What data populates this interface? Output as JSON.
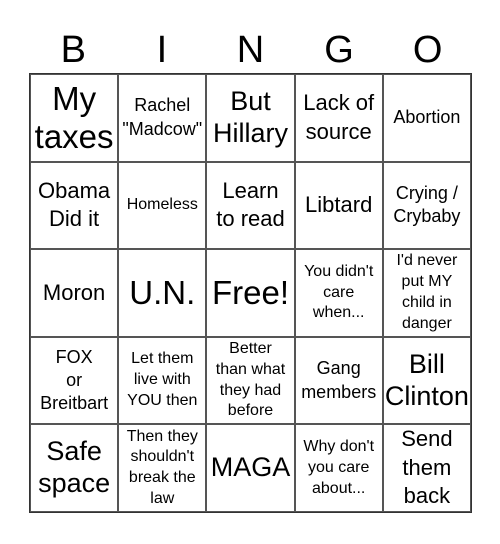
{
  "header": [
    "B",
    "I",
    "N",
    "G",
    "O"
  ],
  "cells": [
    {
      "text": "My\ntaxes",
      "size": "s-xl"
    },
    {
      "text": "Rachel\n\"Madcow\"",
      "size": "s-s"
    },
    {
      "text": "But\nHillary",
      "size": "s-l"
    },
    {
      "text": "Lack of\nsource",
      "size": "s-m"
    },
    {
      "text": "Abortion",
      "size": "s-s"
    },
    {
      "text": "Obama\nDid it",
      "size": "s-m"
    },
    {
      "text": "Homeless",
      "size": "s-xs"
    },
    {
      "text": "Learn\nto read",
      "size": "s-m"
    },
    {
      "text": "Libtard",
      "size": "s-m"
    },
    {
      "text": "Crying /\nCrybaby",
      "size": "s-s"
    },
    {
      "text": "Moron",
      "size": "s-m"
    },
    {
      "text": "U.N.",
      "size": "s-xl"
    },
    {
      "text": "Free!",
      "size": "s-xl"
    },
    {
      "text": "You didn't\ncare\nwhen...",
      "size": "s-xs"
    },
    {
      "text": "I'd never\nput MY\nchild in\ndanger",
      "size": "s-xs"
    },
    {
      "text": "FOX\nor\nBreitbart",
      "size": "s-s"
    },
    {
      "text": "Let them\nlive with\nYOU then",
      "size": "s-xs"
    },
    {
      "text": "Better\nthan what\nthey had\nbefore",
      "size": "s-xs"
    },
    {
      "text": "Gang\nmembers",
      "size": "s-s"
    },
    {
      "text": "Bill\nClinton",
      "size": "s-l"
    },
    {
      "text": "Safe\nspace",
      "size": "s-l"
    },
    {
      "text": "Then they\nshouldn't\nbreak the\nlaw",
      "size": "s-xs"
    },
    {
      "text": "MAGA",
      "size": "s-l"
    },
    {
      "text": "Why don't\nyou care\nabout...",
      "size": "s-xs"
    },
    {
      "text": "Send\nthem\nback",
      "size": "s-m"
    }
  ]
}
